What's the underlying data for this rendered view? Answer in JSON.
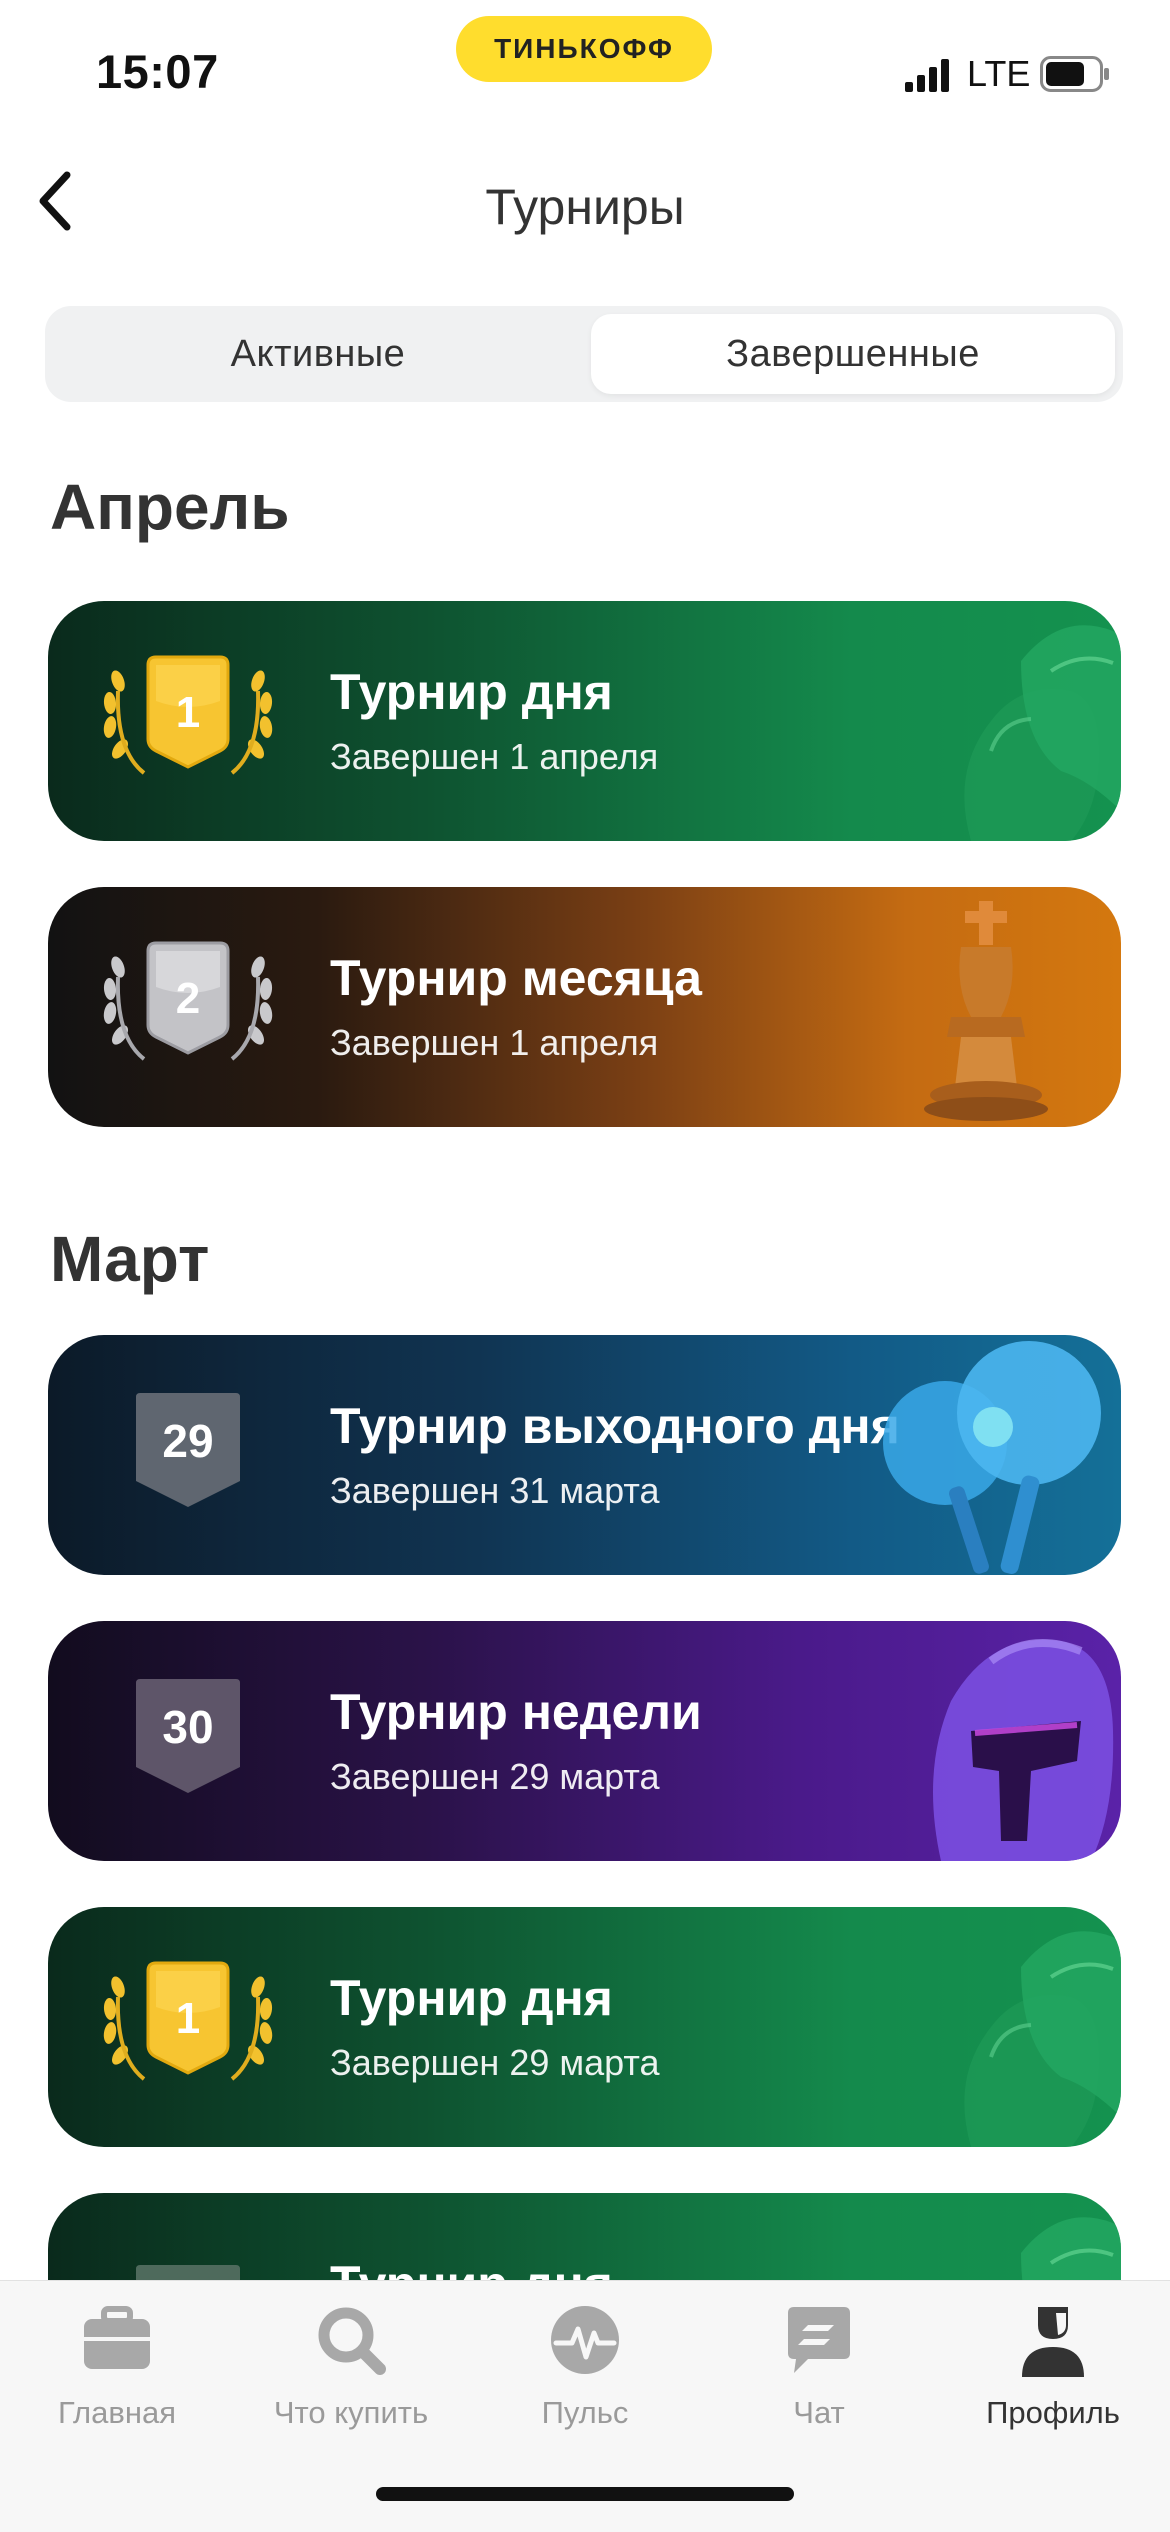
{
  "status_bar": {
    "time": "15:07",
    "brand": "ТИНЬКОФФ",
    "network": "LTE",
    "icons": [
      "signal-icon",
      "battery-icon"
    ]
  },
  "nav": {
    "title": "Турниры",
    "back_icon": "chevron-left-icon"
  },
  "segmented": {
    "tabs": [
      {
        "label": "Активные",
        "selected": false
      },
      {
        "label": "Завершенные",
        "selected": true
      }
    ]
  },
  "sections": [
    {
      "title": "Апрель",
      "cards": [
        {
          "title": "Турнир дня",
          "subtitle": "Завершен 1 апреля",
          "place": "1",
          "badge": "gold-laurel",
          "art": "boxing-gloves",
          "theme": "green"
        },
        {
          "title": "Турнир месяца",
          "subtitle": "Завершен 1 апреля",
          "place": "2",
          "badge": "silver-laurel",
          "art": "chess-king",
          "theme": "orange"
        }
      ]
    },
    {
      "title": "Март",
      "cards": [
        {
          "title": "Турнир выходного дня",
          "subtitle": "Завершен 31 марта",
          "place": "29",
          "badge": "gray-shield",
          "art": "ping-pong",
          "theme": "blue"
        },
        {
          "title": "Турнир недели",
          "subtitle": "Завершен 29 марта",
          "place": "30",
          "badge": "gray-shield",
          "art": "gladiator-helmet",
          "theme": "purple"
        },
        {
          "title": "Турнир дня",
          "subtitle": "Завершен 29 марта",
          "place": "1",
          "badge": "gold-laurel",
          "art": "boxing-gloves",
          "theme": "green"
        },
        {
          "title": "Турнир дня",
          "subtitle": "",
          "place": "",
          "badge": "gray-shield",
          "art": "boxing-gloves",
          "theme": "green",
          "partially_visible": true
        }
      ]
    }
  ],
  "tab_bar": {
    "items": [
      {
        "label": "Главная",
        "icon": "briefcase-icon",
        "active": false
      },
      {
        "label": "Что купить",
        "icon": "search-icon",
        "active": false
      },
      {
        "label": "Пульс",
        "icon": "pulse-icon",
        "active": false
      },
      {
        "label": "Чат",
        "icon": "chat-icon",
        "active": false
      },
      {
        "label": "Профиль",
        "icon": "profile-icon",
        "active": true
      }
    ]
  },
  "colors": {
    "brand_yellow": "#ffdd2d",
    "text_primary": "#333333",
    "tab_inactive": "#9a9a9a",
    "gold": "#f5c02e",
    "silver": "#c9c9cc",
    "shield_gray": "#6b6f78"
  }
}
